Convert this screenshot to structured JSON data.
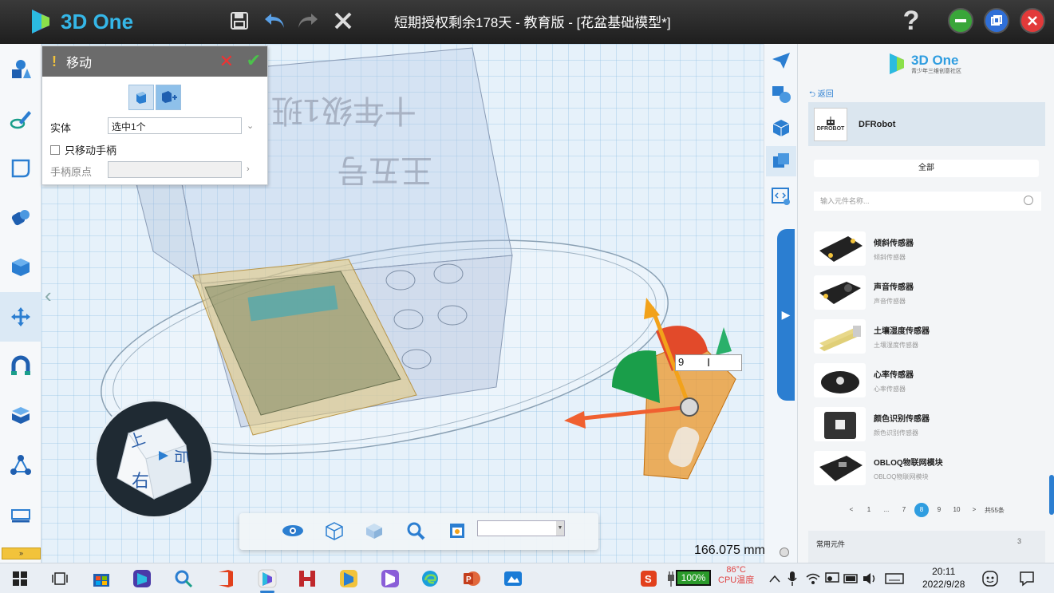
{
  "app": {
    "brand": "3D One",
    "title": "短期授权剩余178天 - 教育版 - [花盆基础模型*]"
  },
  "titlebar_icons": [
    "save-icon",
    "undo-icon",
    "redo-icon",
    "close-tool-icon",
    "help-icon"
  ],
  "window_buttons": [
    "minimize",
    "restore",
    "close"
  ],
  "left_toolbar": [
    "basic-shapes-icon",
    "sketch-draw-icon",
    "sketch-edit-icon",
    "special-features-icon",
    "feature-edit-icon",
    "move-icon",
    "combine-icon",
    "assembly-icon",
    "distance-measure-icon",
    "measure-icon"
  ],
  "left_expand": "»",
  "move_panel": {
    "title": "移动",
    "entity_label": "实体",
    "entity_value": "选中1个",
    "only_handle_label": "只移动手柄",
    "handle_origin_label": "手柄原点"
  },
  "viewport": {
    "input_value": "9",
    "measurement": "166.075 mm"
  },
  "viewcube": {
    "face_top": "上",
    "face_front": "右",
    "face_side": "后"
  },
  "library": {
    "logo": "3D One",
    "logo_sub": "青少年三维创意社区",
    "back": "返回",
    "brand": "DFRobot",
    "brand_logo_text": "DFROBOT",
    "category": "全部",
    "search_placeholder": "输入元件名称...",
    "items": [
      {
        "name": "倾斜传感器",
        "sub": "倾斜传感器"
      },
      {
        "name": "声音传感器",
        "sub": "声音传感器"
      },
      {
        "name": "土壤湿度传感器",
        "sub": "土壤湿度传感器"
      },
      {
        "name": "心率传感器",
        "sub": "心率传感器"
      },
      {
        "name": "颜色识别传感器",
        "sub": "颜色识别传感器"
      },
      {
        "name": "OBLOQ物联网模块",
        "sub": "OBLOQ物联网模块"
      }
    ],
    "pager": [
      "<",
      "1",
      "...",
      "7",
      "8",
      "9",
      "10",
      ">",
      "共55条"
    ],
    "current_page": "8",
    "common_label": "常用元件",
    "common_count": "3"
  },
  "taskbar": {
    "battery": "100%",
    "cpu_temp": "86°C",
    "cpu_label": "CPU温度",
    "time": "20:11",
    "date": "2022/9/28"
  }
}
